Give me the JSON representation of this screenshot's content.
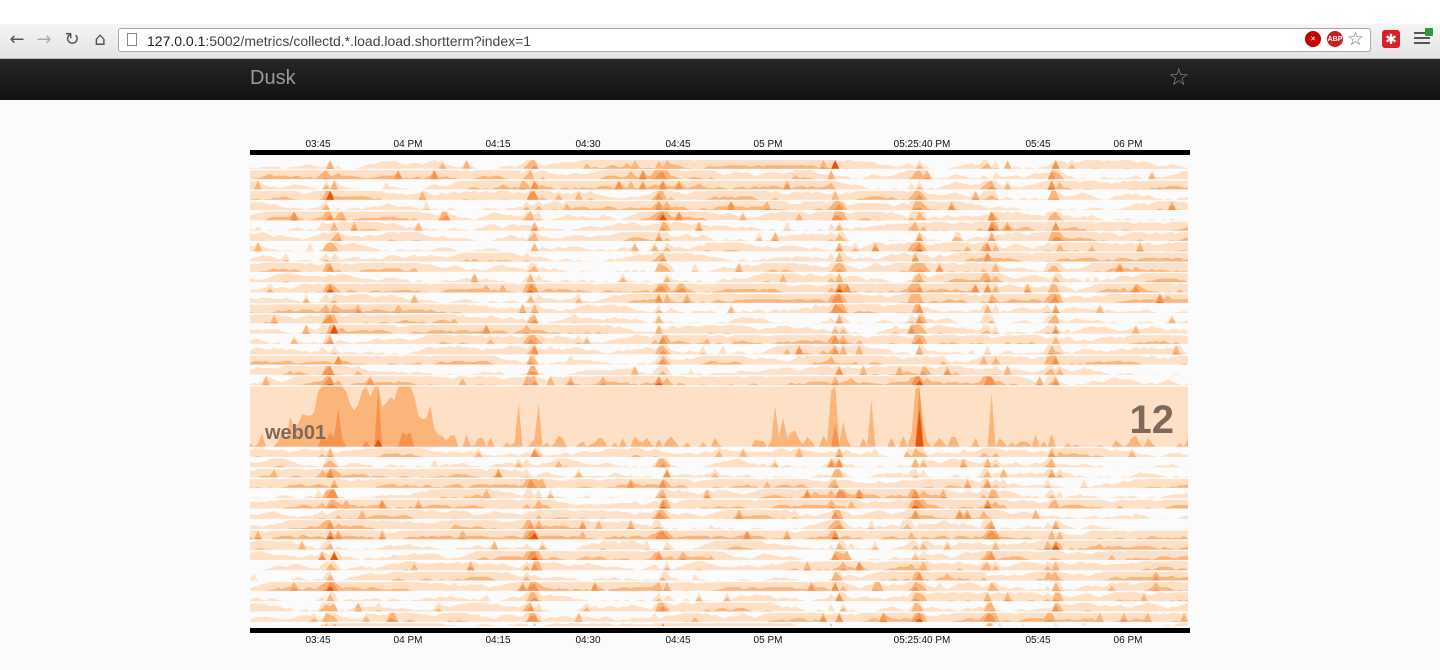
{
  "browser": {
    "url_host": "127.0.0.1",
    "url_rest": ":5002/metrics/collectd.*.load.load.shortterm?index=1",
    "buttons": {
      "back_icon": "arrow-left-icon",
      "forward_icon": "arrow-right-icon",
      "reload_icon": "reload-icon",
      "home_icon": "home-icon"
    },
    "extensions": [
      {
        "name": "block-extension-icon",
        "label": "✕"
      },
      {
        "name": "adblock-extension-icon",
        "label": "ABP"
      },
      {
        "name": "red-extension-icon",
        "label": "✱"
      }
    ]
  },
  "app": {
    "brand": "Dusk",
    "favorite_icon": "star-icon"
  },
  "chart_data": {
    "type": "horizon",
    "metric": "collectd.*.load.load.shortterm",
    "time_ticks": [
      "03:45",
      "04 PM",
      "04:15",
      "04:30",
      "04:45",
      "05 PM",
      "05:25:40 PM",
      "05:45",
      "06 PM"
    ],
    "rows": 44,
    "highlighted_row": {
      "index": 22,
      "label": "web01",
      "value": "12"
    },
    "colors": {
      "band1": "#fde0c5",
      "band2": "#fbb47a",
      "band3": "#f5934f",
      "band4": "#e6550d"
    }
  }
}
